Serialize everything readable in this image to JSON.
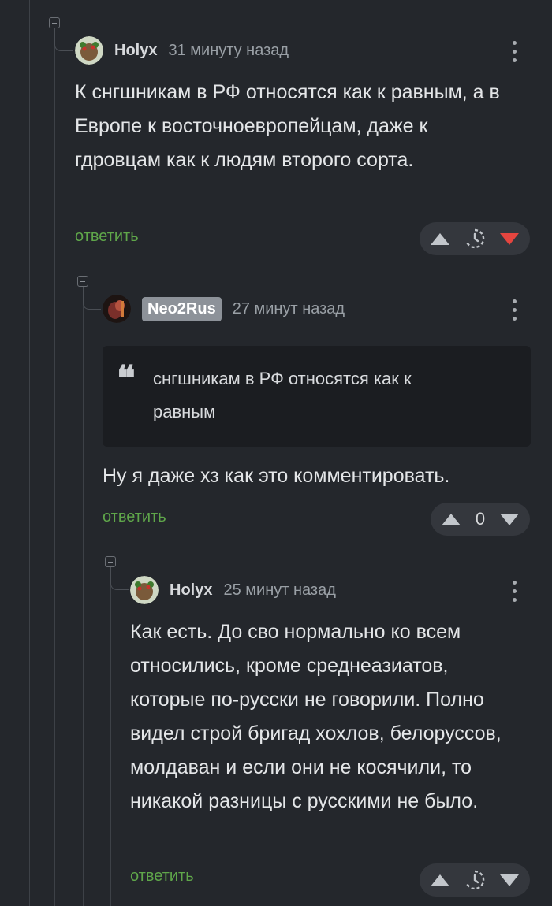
{
  "comments": [
    {
      "username": "Holyx",
      "time": "31 минуту назад",
      "text": "К снгшникам в РФ относятся как к равным, а в Европе к восточноевропейцам, даже к гдровцам как к людям второго сорта.",
      "reply_label": "ответить",
      "score": null,
      "voted": "down"
    },
    {
      "username": "Neo2Rus",
      "time": "27 минут назад",
      "quote": "снгшникам в РФ относятся как к равным",
      "quote_mark": "❝",
      "text": "Ну я даже хз как это комментировать.",
      "reply_label": "ответить",
      "score": "0"
    },
    {
      "username": "Holyx",
      "time": "25 минут назад",
      "text": "Как есть. До сво нормально ко всем относились, кроме среднеазиатов, которые по-русски не говорили. Полно видел строй бригад хохлов, белоруссов, молдаван и если они не косячили, то никакой разницы с русскими не было.",
      "reply_label": "ответить",
      "score": null
    }
  ],
  "colors": {
    "background": "#24272c",
    "link_green": "#5fa64a",
    "downvote_red": "#e5453f"
  },
  "icons": [
    "collapse-icon",
    "more-icon",
    "upvote-icon",
    "downvote-icon",
    "hidden-score-clock-icon",
    "quote-icon"
  ]
}
